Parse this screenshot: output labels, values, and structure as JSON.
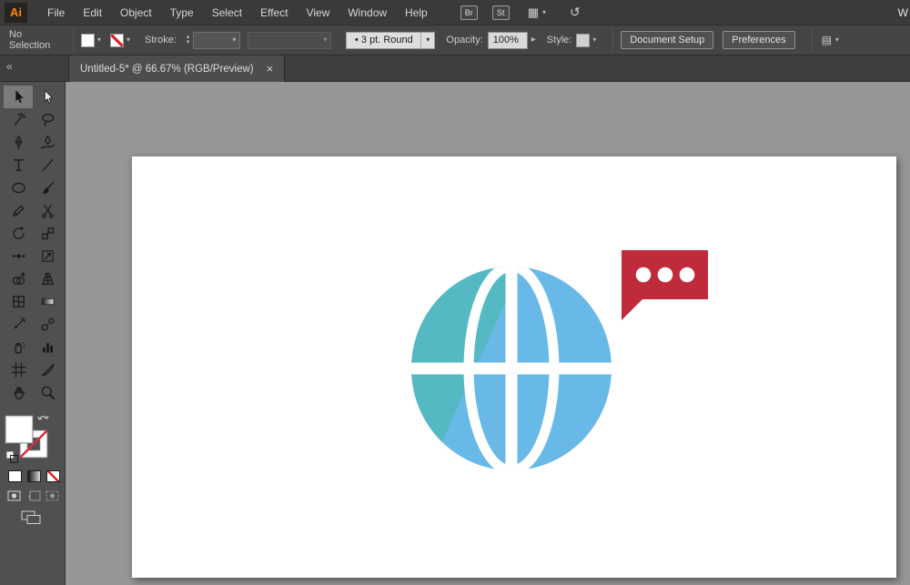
{
  "icons": {
    "chevron_down": "▾",
    "chevron_up": "▴",
    "chevron_right": "▸",
    "collapse": "«",
    "close": "×",
    "workspace_grid": "▦",
    "panel_rows": "▤",
    "sync": "↺",
    "window_overflow": "W"
  },
  "menu_bar": {
    "logo_text": "Ai",
    "items": [
      "File",
      "Edit",
      "Object",
      "Type",
      "Select",
      "Effect",
      "View",
      "Window",
      "Help"
    ],
    "bridge_label": "Br",
    "stock_label": "St"
  },
  "control_bar": {
    "selection_status": "No Selection",
    "stroke_label": "Stroke:",
    "stroke_weight_value": "",
    "brush_value": "• 3 pt. Round",
    "opacity_label": "Opacity:",
    "opacity_value": "100%",
    "style_label": "Style:",
    "document_setup_label": "Document Setup",
    "preferences_label": "Preferences"
  },
  "document_tab": {
    "title": "Untitled-5* @ 66.67% (RGB/Preview)"
  },
  "tools": {
    "selected": "selection",
    "order": [
      "selection",
      "direct-selection",
      "magic-wand",
      "lasso",
      "pen",
      "curvature",
      "type",
      "line-segment",
      "ellipse",
      "paintbrush",
      "pencil",
      "scissors",
      "rotate",
      "scale",
      "width",
      "free-transform",
      "shape-builder",
      "perspective-grid",
      "mesh",
      "gradient",
      "eyedropper",
      "blend",
      "symbol-sprayer",
      "column-graph",
      "artboard",
      "slice",
      "hand",
      "zoom"
    ]
  },
  "colors": {
    "globe_teal": "#55b9c3",
    "globe_blue": "#68b8e8",
    "bubble_red": "#c02b3c",
    "logo_orange": "#ff8a00",
    "canvas_bg": "#969696"
  },
  "artboard_graphic": {
    "bubble_dot_count": 3
  }
}
